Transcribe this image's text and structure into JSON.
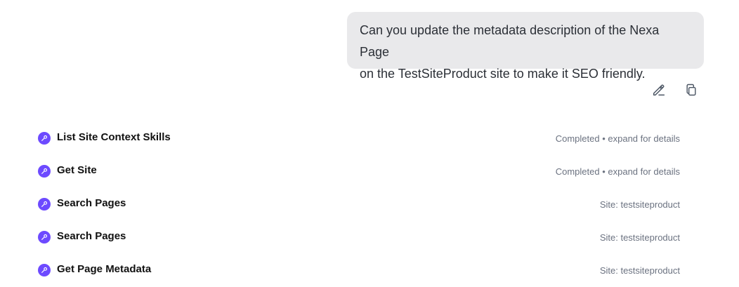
{
  "message": {
    "text_line1": "Can you update the metadata description of the Nexa Page",
    "text_line2": "on the TestSiteProduct site to make it SEO friendly.",
    "actions": {
      "edit_icon": "pencil-icon",
      "copy_icon": "copy-icon"
    }
  },
  "tools": [
    {
      "name": "List Site Context Skills",
      "status": "Completed • expand for details",
      "icon": "wrench-icon"
    },
    {
      "name": "Get Site",
      "status": "Completed • expand for details",
      "icon": "wrench-icon"
    },
    {
      "name": "Search Pages",
      "status": "Site: testsiteproduct",
      "icon": "wrench-icon"
    },
    {
      "name": "Search Pages",
      "status": "Site: testsiteproduct",
      "icon": "wrench-icon"
    },
    {
      "name": "Get Page Metadata",
      "status": "Site: testsiteproduct",
      "icon": "wrench-icon"
    }
  ],
  "colors": {
    "bubble_bg": "#e9e9eb",
    "tool_icon_bg": "#6d4aff",
    "status_text": "#6b7280"
  }
}
